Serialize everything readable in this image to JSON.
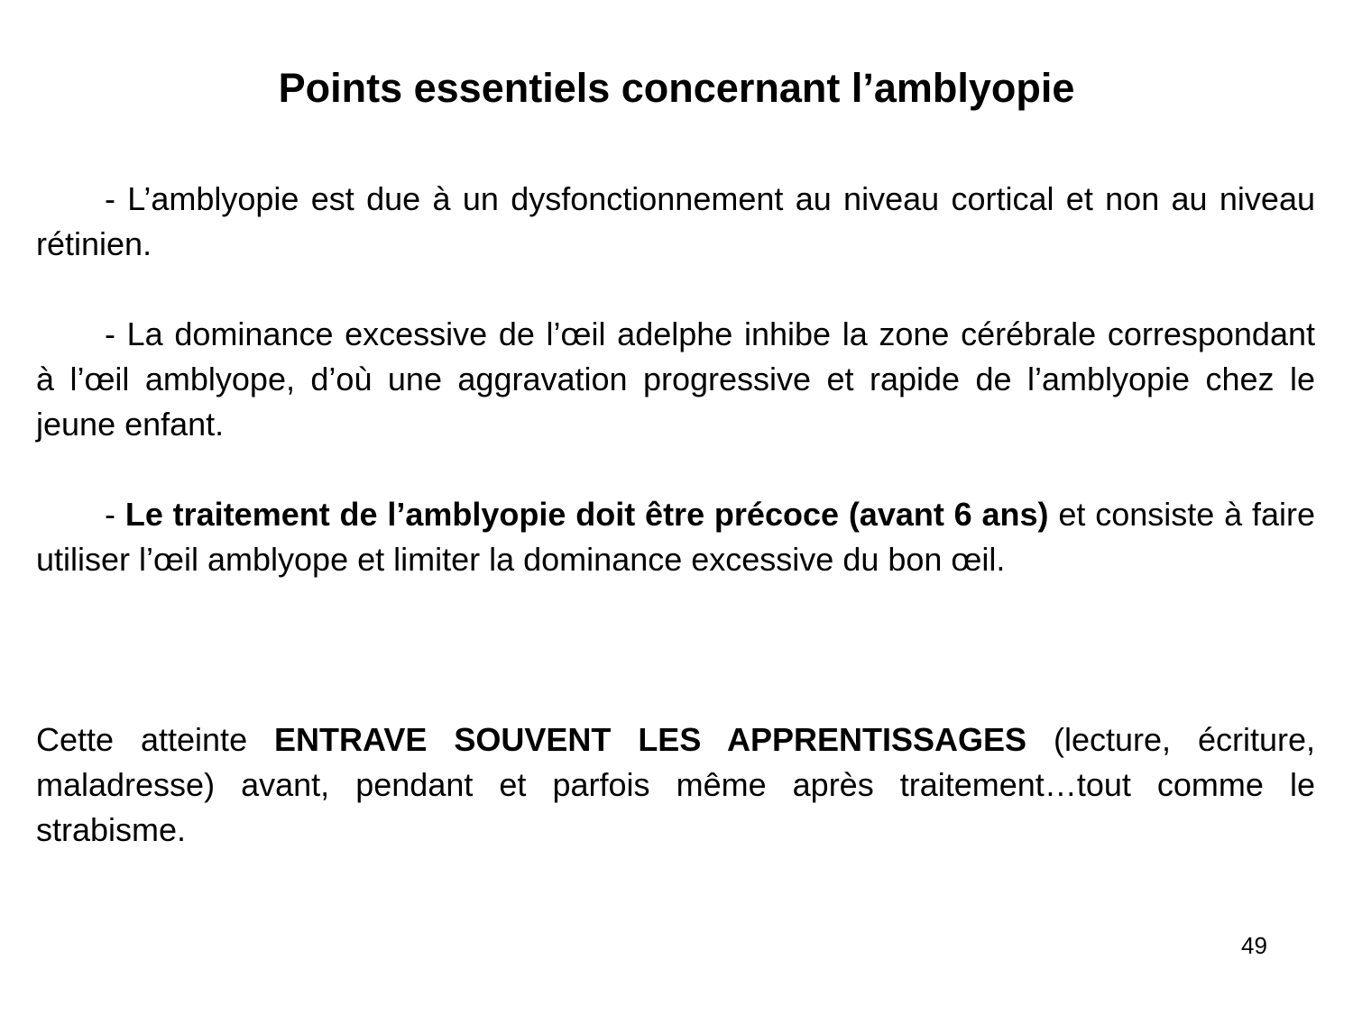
{
  "title": "Points essentiels concernant l’amblyopie",
  "paragraphs": {
    "p1": {
      "text": "- L’amblyopie est due à un dysfonctionnement au niveau cortical et non au niveau rétinien."
    },
    "p2": {
      "text": "- La dominance excessive de l’œil adelphe inhibe la zone cérébrale correspondant à l’œil amblyope, d’où une aggravation progressive et rapide de l’amblyopie chez le jeune enfant."
    },
    "p3": {
      "prefix": "- ",
      "bold": "Le traitement de l’amblyopie doit être précoce (avant 6 ans)",
      "suffix": " et consiste à faire utiliser l’œil amblyope et limiter la dominance excessive du bon œil."
    },
    "p4": {
      "prefix": "Cette atteinte ",
      "bold": "ENTRAVE SOUVENT LES APPRENTISSAGES",
      "suffix": " (lecture, écriture, maladresse) avant, pendant et parfois même après traitement…tout comme le strabisme."
    }
  },
  "page_number": "49"
}
